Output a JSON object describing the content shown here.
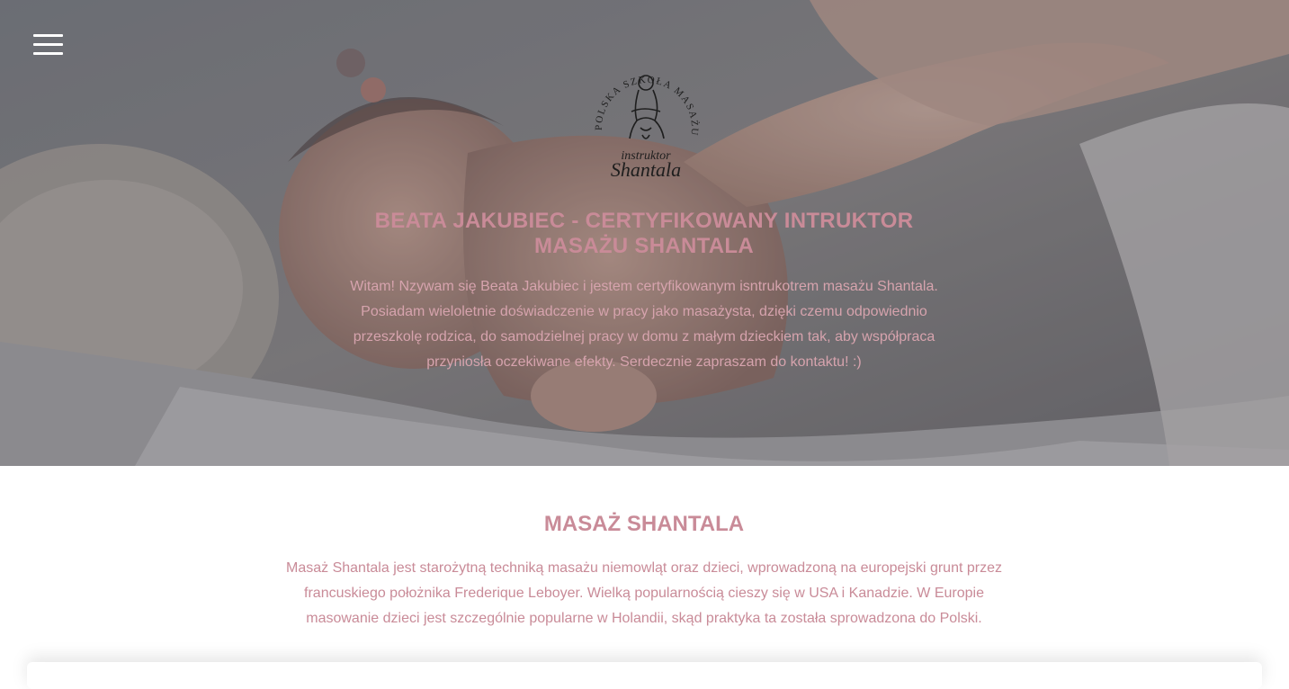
{
  "colors": {
    "accent": "#c98b98",
    "hero_text": "#d6a3ad",
    "menu_icon": "#ffffff"
  },
  "header": {
    "menu_icon": "hamburger-menu-icon"
  },
  "logo": {
    "arc_text": "POLSKA SZKOŁA MASAŻU",
    "subtitle": "instruktor",
    "name": "Shantala"
  },
  "hero": {
    "title": "BEATA JAKUBIEC - CERTYFIKOWANY INTRUKTOR MASAŻU SHANTALA",
    "text": "Witam! Nzywam się Beata Jakubiec i jestem certyfikowanym isntrukotrem masażu Shantala. Posiadam wieloletnie doświadczenie w pracy jako masażysta, dzięki czemu odpowiednio przeszkolę rodzica, do samodzielnej pracy w domu z małym dzieckiem tak, aby współpraca przyniosła oczekiwane efekty. Serdecznie zapraszam do kontaktu! :)"
  },
  "section": {
    "title": "MASAŻ SHANTALA",
    "text": "Masaż Shantala jest starożytną techniką masażu niemowląt oraz dzieci, wprowadzoną na europejski grunt przez francuskiego położnika Frederique Leboyer. Wielką popularnością cieszy się w USA i Kanadzie. W Europie masowanie dzieci jest szczególnie popularne w Holandii, skąd praktyka ta została sprowadzona do Polski."
  }
}
